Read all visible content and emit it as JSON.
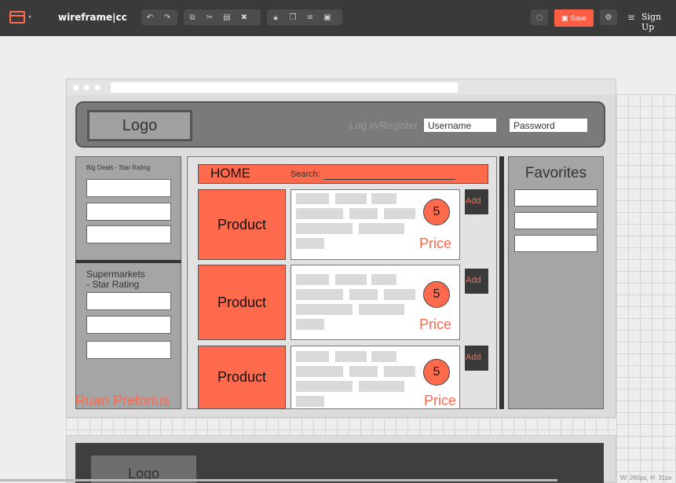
{
  "toolbar": {
    "brand": "wireframe|cc",
    "edit_icons": [
      "undo-icon",
      "redo-icon"
    ],
    "clip_icons": [
      "copy-icon",
      "cut-icon",
      "paste-icon",
      "delete-icon"
    ],
    "arrange_icons": [
      "lock-icon",
      "duplicate-icon",
      "align-icon",
      "group-icon"
    ],
    "save_label": "Save",
    "sign_up_label": "Sign Up",
    "accent_color": "#ff5d44"
  },
  "wireframe": {
    "header": {
      "logo": "Logo",
      "login_label": "Log in/Register",
      "username_placeholder": "Username",
      "password_placeholder": "Password"
    },
    "left": {
      "big_deals_label": "Big Deals - Star Rating",
      "supermarkets_label_line1": "Supermarkets",
      "supermarkets_label_line2": "- Star Rating",
      "author": "Ruan Pretorius"
    },
    "center": {
      "home_title": "HOME",
      "search_label": "Search:",
      "products": [
        {
          "name": "Product",
          "rating": "5",
          "price": "Price",
          "add": "Add"
        },
        {
          "name": "Product",
          "rating": "5",
          "price": "Price",
          "add": "Add"
        },
        {
          "name": "Product",
          "rating": "5",
          "price": "Price",
          "add": "Add"
        }
      ]
    },
    "right": {
      "favorites_title": "Favorites"
    },
    "page2": {
      "logo": "Logo"
    }
  },
  "status": {
    "dims": "W: 260px, H: 31px"
  }
}
